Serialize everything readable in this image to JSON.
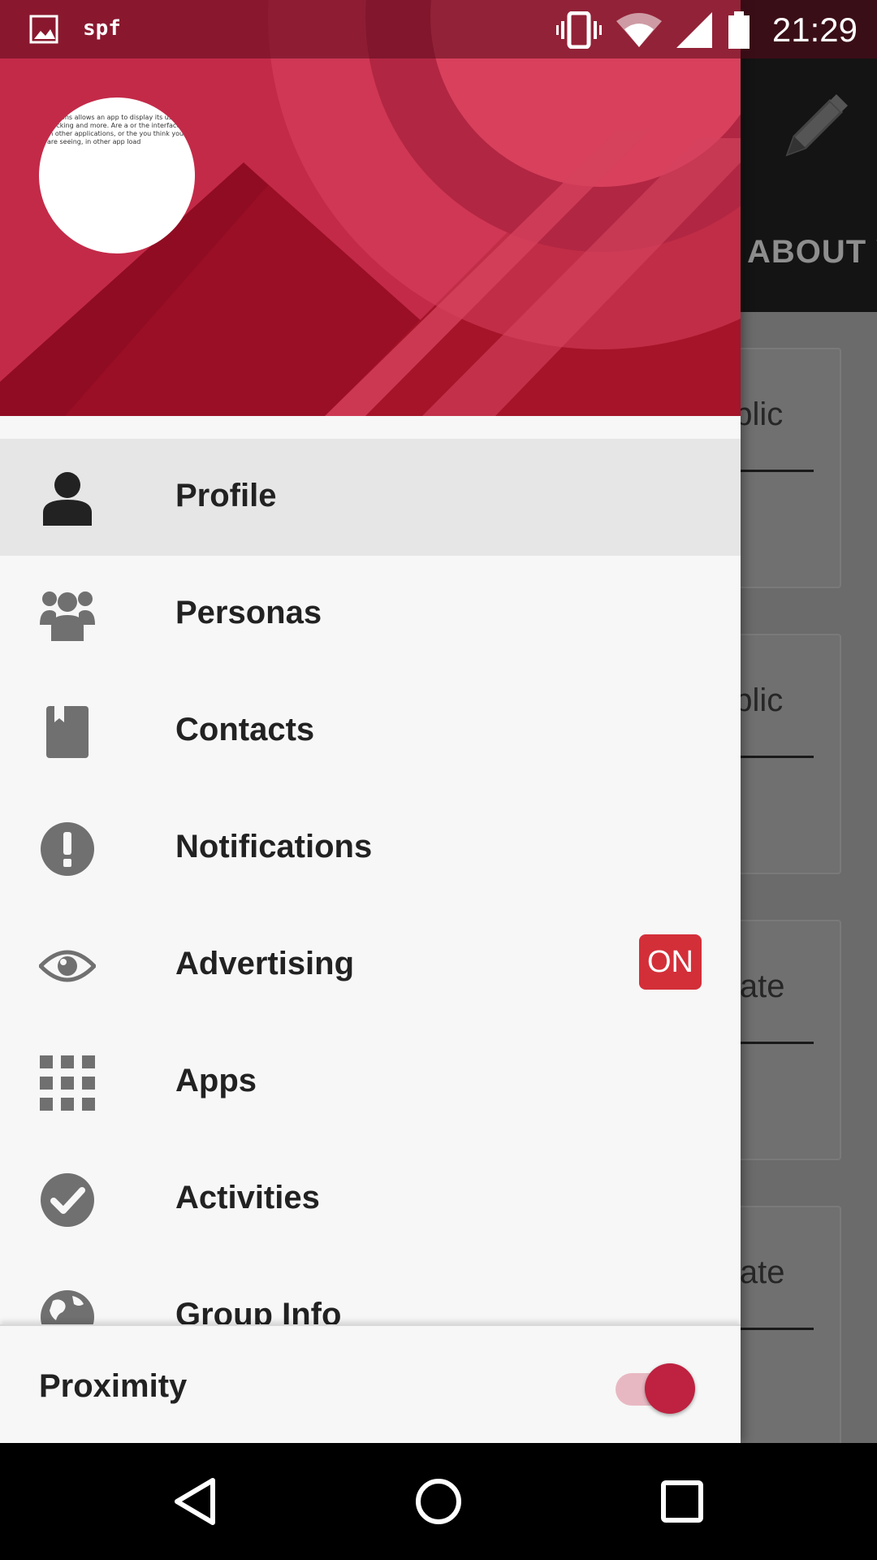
{
  "status_bar": {
    "app_label": "spf",
    "time": "21:29"
  },
  "background_app": {
    "tab_label": "ABOUT Y",
    "cards": [
      {
        "value": "ublic"
      },
      {
        "value": "ublic"
      },
      {
        "value": "ivate"
      },
      {
        "value": "ivate"
      }
    ]
  },
  "drawer": {
    "avatar_text": "Persons allows an app to display its usage tracking and more. Are a or the interface in other applications, or the you think you are seeing, in other app load",
    "menu": [
      {
        "label": "Profile",
        "icon": "person-icon",
        "active": true
      },
      {
        "label": "Personas",
        "icon": "group-icon"
      },
      {
        "label": "Contacts",
        "icon": "contact-book-icon"
      },
      {
        "label": "Notifications",
        "icon": "alert-circle-icon"
      },
      {
        "label": "Advertising",
        "icon": "eye-icon",
        "badge": "ON"
      },
      {
        "label": "Apps",
        "icon": "apps-grid-icon"
      },
      {
        "label": "Activities",
        "icon": "check-circle-icon"
      },
      {
        "label": "Group Info",
        "icon": "globe-icon"
      }
    ],
    "footer": {
      "label": "Proximity",
      "toggle_on": true
    }
  },
  "colors": {
    "accent": "#c42746",
    "badge": "#d32f39",
    "toggle_thumb": "#bf2140"
  }
}
